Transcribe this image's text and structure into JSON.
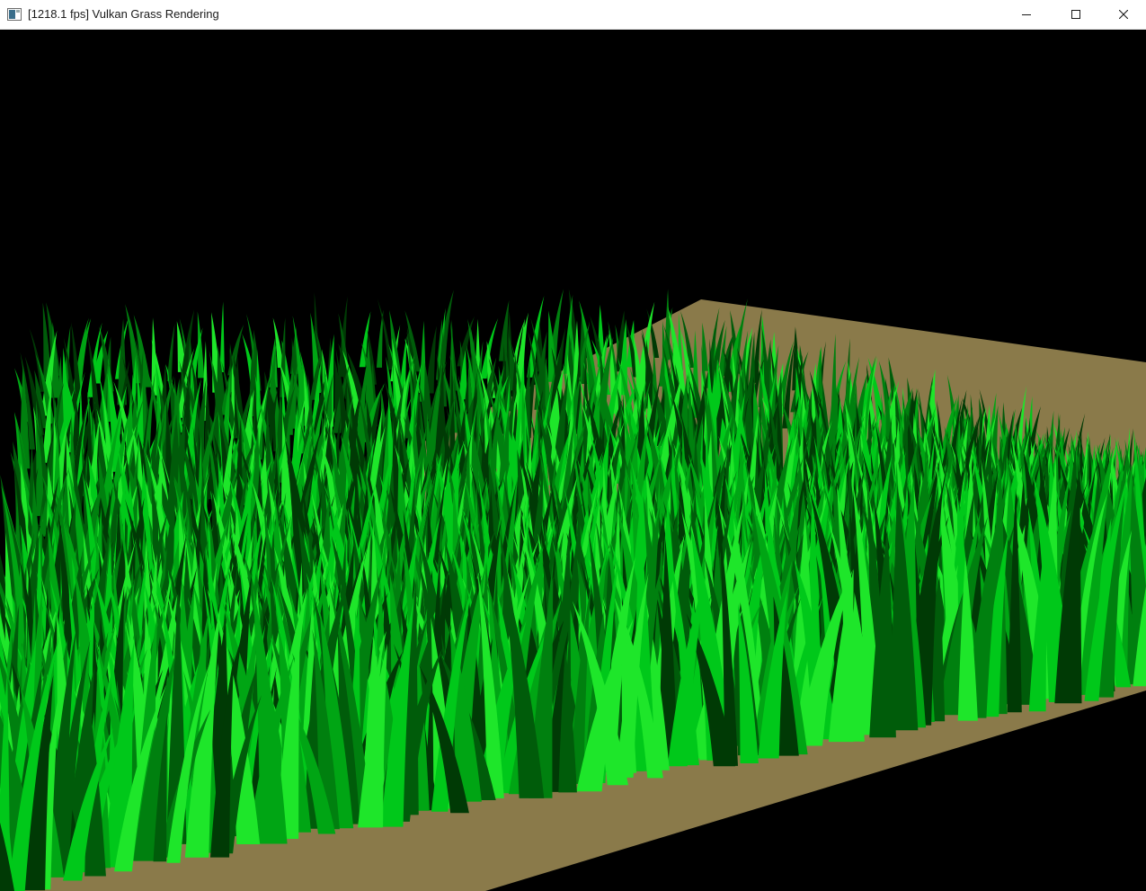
{
  "window": {
    "title": "[1218.1 fps] Vulkan Grass Rendering",
    "controls": {
      "minimize_icon": "minimize-icon",
      "maximize_icon": "maximize-icon",
      "close_icon": "close-icon"
    }
  },
  "scene": {
    "background_color": "#000000",
    "ground_color": "#8a7a4a",
    "blade_colors": [
      "#003a05",
      "#005c0a",
      "#00800f",
      "#00a514",
      "#00c81a",
      "#1ee62a"
    ]
  }
}
